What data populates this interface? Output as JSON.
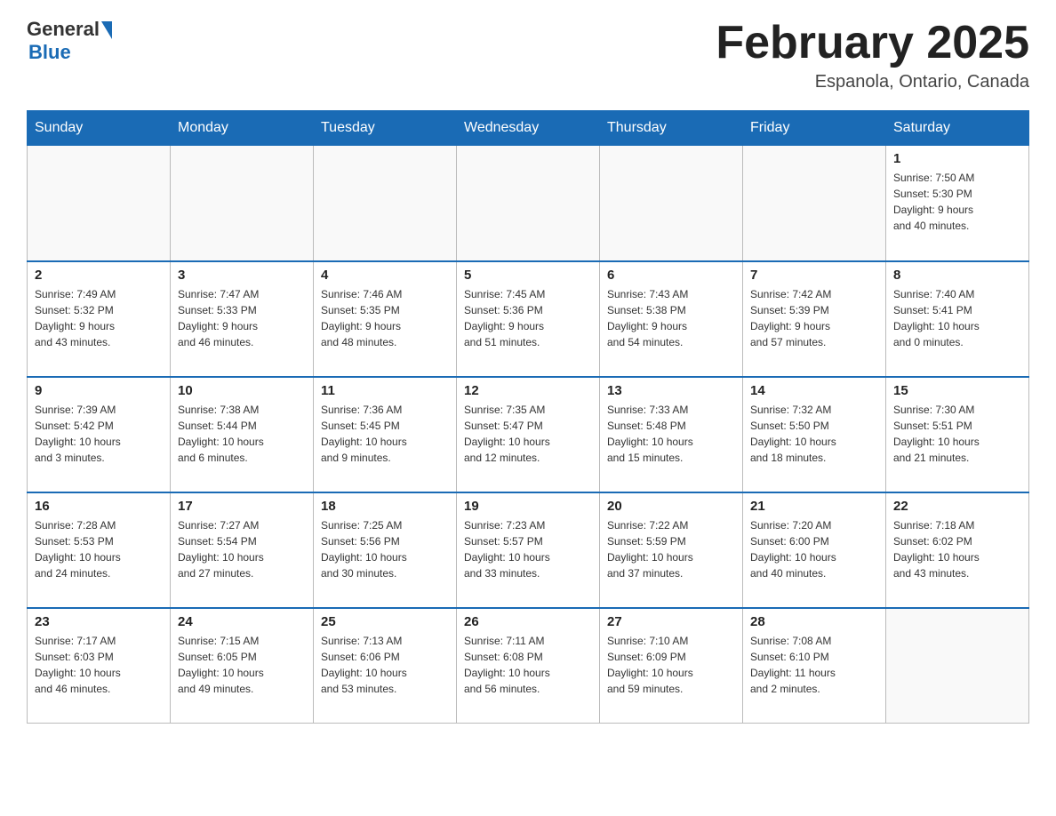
{
  "logo": {
    "general": "General",
    "blue": "Blue"
  },
  "header": {
    "title": "February 2025",
    "location": "Espanola, Ontario, Canada"
  },
  "weekdays": [
    "Sunday",
    "Monday",
    "Tuesday",
    "Wednesday",
    "Thursday",
    "Friday",
    "Saturday"
  ],
  "weeks": [
    [
      {
        "day": "",
        "info": ""
      },
      {
        "day": "",
        "info": ""
      },
      {
        "day": "",
        "info": ""
      },
      {
        "day": "",
        "info": ""
      },
      {
        "day": "",
        "info": ""
      },
      {
        "day": "",
        "info": ""
      },
      {
        "day": "1",
        "info": "Sunrise: 7:50 AM\nSunset: 5:30 PM\nDaylight: 9 hours\nand 40 minutes."
      }
    ],
    [
      {
        "day": "2",
        "info": "Sunrise: 7:49 AM\nSunset: 5:32 PM\nDaylight: 9 hours\nand 43 minutes."
      },
      {
        "day": "3",
        "info": "Sunrise: 7:47 AM\nSunset: 5:33 PM\nDaylight: 9 hours\nand 46 minutes."
      },
      {
        "day": "4",
        "info": "Sunrise: 7:46 AM\nSunset: 5:35 PM\nDaylight: 9 hours\nand 48 minutes."
      },
      {
        "day": "5",
        "info": "Sunrise: 7:45 AM\nSunset: 5:36 PM\nDaylight: 9 hours\nand 51 minutes."
      },
      {
        "day": "6",
        "info": "Sunrise: 7:43 AM\nSunset: 5:38 PM\nDaylight: 9 hours\nand 54 minutes."
      },
      {
        "day": "7",
        "info": "Sunrise: 7:42 AM\nSunset: 5:39 PM\nDaylight: 9 hours\nand 57 minutes."
      },
      {
        "day": "8",
        "info": "Sunrise: 7:40 AM\nSunset: 5:41 PM\nDaylight: 10 hours\nand 0 minutes."
      }
    ],
    [
      {
        "day": "9",
        "info": "Sunrise: 7:39 AM\nSunset: 5:42 PM\nDaylight: 10 hours\nand 3 minutes."
      },
      {
        "day": "10",
        "info": "Sunrise: 7:38 AM\nSunset: 5:44 PM\nDaylight: 10 hours\nand 6 minutes."
      },
      {
        "day": "11",
        "info": "Sunrise: 7:36 AM\nSunset: 5:45 PM\nDaylight: 10 hours\nand 9 minutes."
      },
      {
        "day": "12",
        "info": "Sunrise: 7:35 AM\nSunset: 5:47 PM\nDaylight: 10 hours\nand 12 minutes."
      },
      {
        "day": "13",
        "info": "Sunrise: 7:33 AM\nSunset: 5:48 PM\nDaylight: 10 hours\nand 15 minutes."
      },
      {
        "day": "14",
        "info": "Sunrise: 7:32 AM\nSunset: 5:50 PM\nDaylight: 10 hours\nand 18 minutes."
      },
      {
        "day": "15",
        "info": "Sunrise: 7:30 AM\nSunset: 5:51 PM\nDaylight: 10 hours\nand 21 minutes."
      }
    ],
    [
      {
        "day": "16",
        "info": "Sunrise: 7:28 AM\nSunset: 5:53 PM\nDaylight: 10 hours\nand 24 minutes."
      },
      {
        "day": "17",
        "info": "Sunrise: 7:27 AM\nSunset: 5:54 PM\nDaylight: 10 hours\nand 27 minutes."
      },
      {
        "day": "18",
        "info": "Sunrise: 7:25 AM\nSunset: 5:56 PM\nDaylight: 10 hours\nand 30 minutes."
      },
      {
        "day": "19",
        "info": "Sunrise: 7:23 AM\nSunset: 5:57 PM\nDaylight: 10 hours\nand 33 minutes."
      },
      {
        "day": "20",
        "info": "Sunrise: 7:22 AM\nSunset: 5:59 PM\nDaylight: 10 hours\nand 37 minutes."
      },
      {
        "day": "21",
        "info": "Sunrise: 7:20 AM\nSunset: 6:00 PM\nDaylight: 10 hours\nand 40 minutes."
      },
      {
        "day": "22",
        "info": "Sunrise: 7:18 AM\nSunset: 6:02 PM\nDaylight: 10 hours\nand 43 minutes."
      }
    ],
    [
      {
        "day": "23",
        "info": "Sunrise: 7:17 AM\nSunset: 6:03 PM\nDaylight: 10 hours\nand 46 minutes."
      },
      {
        "day": "24",
        "info": "Sunrise: 7:15 AM\nSunset: 6:05 PM\nDaylight: 10 hours\nand 49 minutes."
      },
      {
        "day": "25",
        "info": "Sunrise: 7:13 AM\nSunset: 6:06 PM\nDaylight: 10 hours\nand 53 minutes."
      },
      {
        "day": "26",
        "info": "Sunrise: 7:11 AM\nSunset: 6:08 PM\nDaylight: 10 hours\nand 56 minutes."
      },
      {
        "day": "27",
        "info": "Sunrise: 7:10 AM\nSunset: 6:09 PM\nDaylight: 10 hours\nand 59 minutes."
      },
      {
        "day": "28",
        "info": "Sunrise: 7:08 AM\nSunset: 6:10 PM\nDaylight: 11 hours\nand 2 minutes."
      },
      {
        "day": "",
        "info": ""
      }
    ]
  ]
}
